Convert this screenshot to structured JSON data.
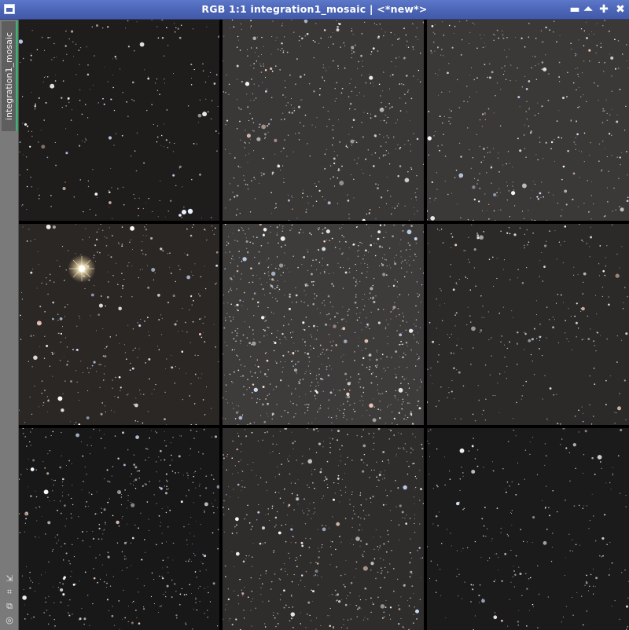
{
  "window": {
    "title": "RGB 1:1 integration1_mosaic | <*new*>",
    "buttons": [
      {
        "name": "minimize-button",
        "glyph": "▬"
      },
      {
        "name": "shade-button",
        "glyph": "⏶"
      },
      {
        "name": "maximize-button",
        "glyph": "✚"
      },
      {
        "name": "close-button",
        "glyph": "✖"
      }
    ]
  },
  "sidebar": {
    "view_tab_label": "integration1_mosaic",
    "tools": [
      {
        "name": "zoom-fit-icon",
        "glyph": "⇲"
      },
      {
        "name": "crop-icon",
        "glyph": "⌗"
      },
      {
        "name": "clone-icon",
        "glyph": "⧉"
      },
      {
        "name": "settings-icon",
        "glyph": "◎"
      }
    ]
  },
  "mosaic": {
    "rows": 3,
    "cols": 3,
    "tiles": [
      {
        "name": "tile-1-1",
        "bg": "#1f1c1c",
        "density": 260,
        "bright_feature": "cluster-bottom"
      },
      {
        "name": "tile-1-2",
        "bg": "#3a3837",
        "density": 520,
        "bright_feature": "none"
      },
      {
        "name": "tile-1-3",
        "bg": "#3b3937",
        "density": 420,
        "bright_feature": "none"
      },
      {
        "name": "tile-2-1",
        "bg": "#2a2725",
        "density": 360,
        "bright_feature": "bright-star"
      },
      {
        "name": "tile-2-2",
        "bg": "#3d3c3b",
        "density": 900,
        "bright_feature": "none"
      },
      {
        "name": "tile-2-3",
        "bg": "#2c2a28",
        "density": 300,
        "bright_feature": "none"
      },
      {
        "name": "tile-3-1",
        "bg": "#181818",
        "density": 480,
        "bright_feature": "none"
      },
      {
        "name": "tile-3-2",
        "bg": "#2f2d2c",
        "density": 620,
        "bright_feature": "none"
      },
      {
        "name": "tile-3-3",
        "bg": "#1c1b1b",
        "density": 260,
        "bright_feature": "none"
      }
    ]
  },
  "colors": {
    "titlebar": "#4a63b4",
    "tab_accent": "#21c26a",
    "grid_lines": "#000000"
  }
}
